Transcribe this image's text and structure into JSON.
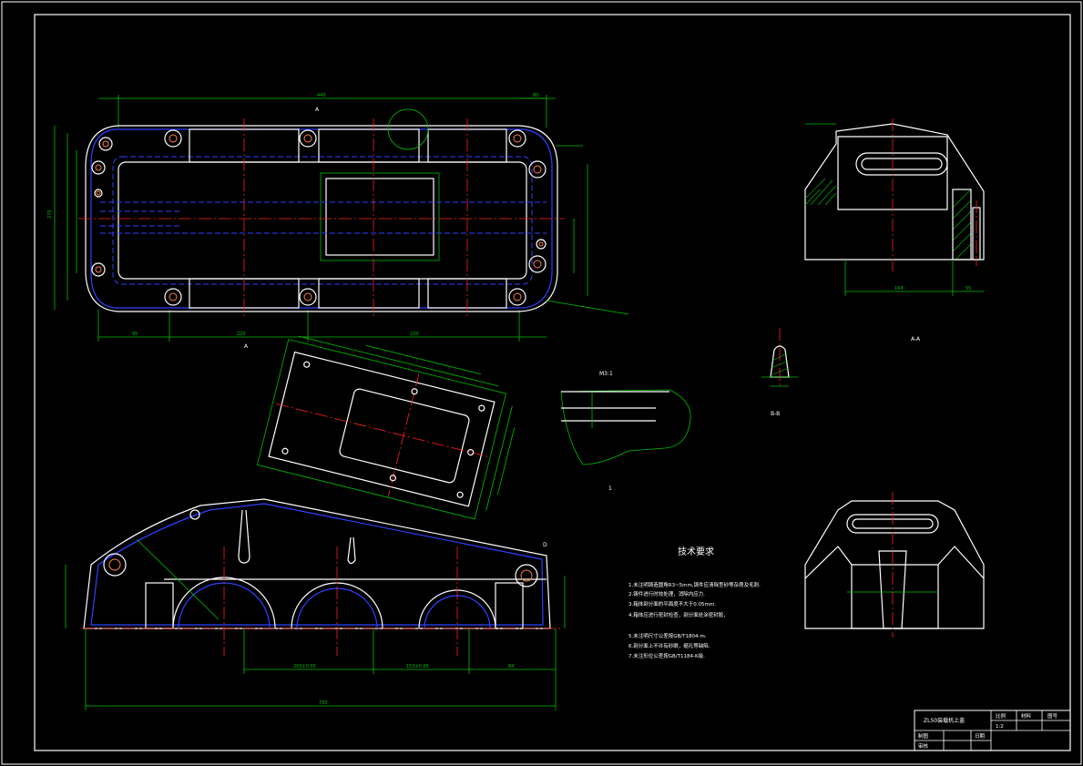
{
  "drawing": {
    "technical_requirements_title": "技术要求",
    "technical_requirements": [
      "1.未注明铸造圆角R3~5mm,铸件应清除型砂等杂质及毛刺.",
      "2.铸件进行时效处理，消除内应力.",
      "3.箱体剖分面的平面度不大于0.05mm.",
      "4.箱体应进行密封检查，剖分面处涂密封胶，",
      "5.未注明尺寸公差按GB/T1804-m.",
      "6.剖分面上不许有砂眼，缩孔等缺陷.",
      "7.未注形位公差按GB/T1184-K级."
    ],
    "view_labels": {
      "section_aa": "A-A",
      "section_bb": "B-B",
      "detail_1": "1",
      "detail_1_scale": "M3:1",
      "section_mark_top": "A",
      "section_mark_bottom": "A",
      "section_mark_d": "D"
    },
    "dimension_labels": {
      "top_overall": "440",
      "top_right": "80",
      "front_overall": "730",
      "front_left": "200±0.05",
      "front_mid": "150±0.05",
      "front_right": "84",
      "top_left_bottom": "95",
      "top_mid_bottom": "220",
      "top_right_bottom": "220",
      "top_height": "270",
      "side_width": "164",
      "side_right": "55"
    }
  },
  "title_block": {
    "name": "ZL50装载机上盖",
    "scale_label": "比例",
    "material_label": "材料",
    "drawing_no_label": "图号",
    "scale_value": "1:2",
    "drawn_label": "制图",
    "checked_label": "审核",
    "date_label": "日期"
  }
}
